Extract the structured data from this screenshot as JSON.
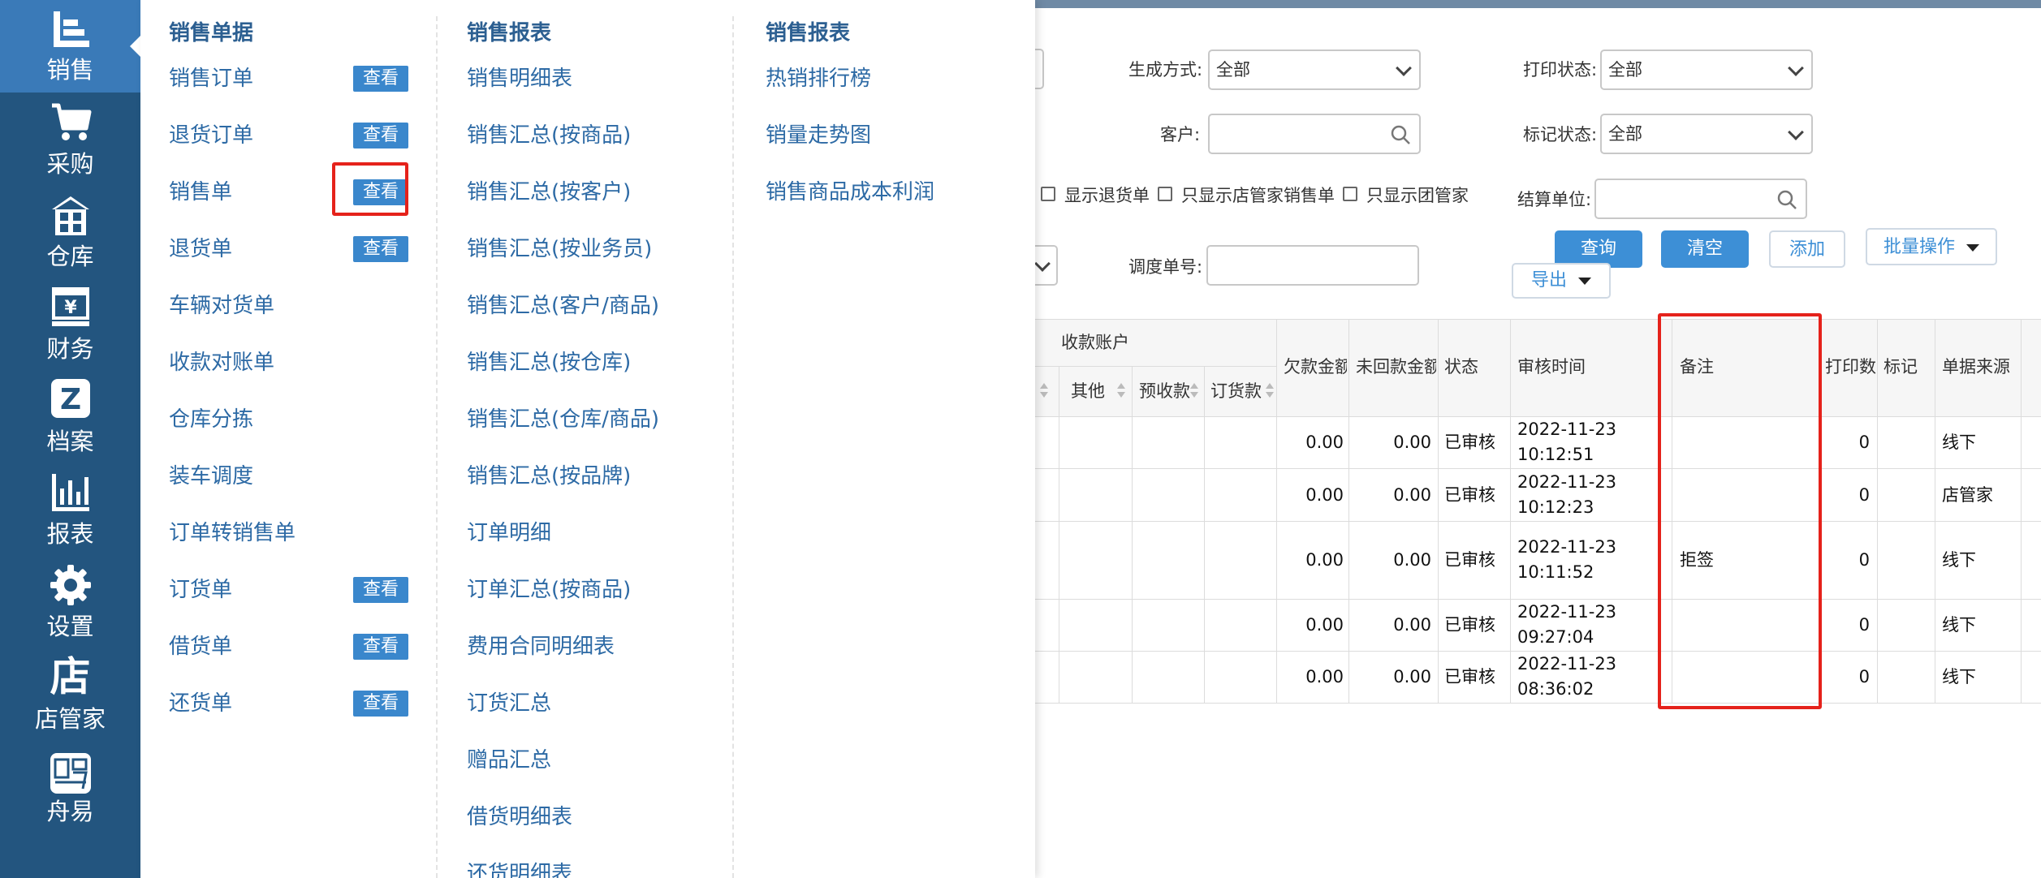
{
  "nav": {
    "items": [
      {
        "label": "销售",
        "icon": "sales-icon"
      },
      {
        "label": "采购",
        "icon": "cart-icon"
      },
      {
        "label": "仓库",
        "icon": "warehouse-icon"
      },
      {
        "label": "财务",
        "icon": "finance-icon"
      },
      {
        "label": "档案",
        "icon": "archive-icon"
      },
      {
        "label": "报表",
        "icon": "report-icon"
      },
      {
        "label": "设置",
        "icon": "gear-icon"
      },
      {
        "label": "店管家",
        "icon": "store-icon"
      },
      {
        "label": "舟易",
        "icon": "zhouyi-icon"
      }
    ]
  },
  "menu": {
    "col1": {
      "title": "销售单据",
      "items": [
        {
          "label": "销售订单",
          "view": "查看"
        },
        {
          "label": "退货订单",
          "view": "查看"
        },
        {
          "label": "销售单",
          "view": "查看"
        },
        {
          "label": "退货单",
          "view": "查看"
        },
        {
          "label": "车辆对货单"
        },
        {
          "label": "收款对账单"
        },
        {
          "label": "仓库分拣"
        },
        {
          "label": "装车调度"
        },
        {
          "label": "订单转销售单"
        },
        {
          "label": "订货单",
          "view": "查看"
        },
        {
          "label": "借货单",
          "view": "查看"
        },
        {
          "label": "还货单",
          "view": "查看"
        }
      ]
    },
    "col2": {
      "title": "销售报表",
      "items": [
        "销售明细表",
        "销售汇总(按商品)",
        "销售汇总(按客户)",
        "销售汇总(按业务员)",
        "销售汇总(客户/商品)",
        "销售汇总(按仓库)",
        "销售汇总(仓库/商品)",
        "销售汇总(按品牌)",
        "订单明细",
        "订单汇总(按商品)",
        "费用合同明细表",
        "订货汇总",
        "赠品汇总",
        "借货明细表",
        "还货明细表"
      ]
    },
    "col3": {
      "title": "销售报表",
      "items": [
        "热销排行榜",
        "销量走势图",
        "销售商品成本利润"
      ]
    }
  },
  "filters": {
    "gen_method_label": "生成方式:",
    "gen_method_value": "全部",
    "print_status_label": "打印状态:",
    "print_status_value": "全部",
    "customer_label": "客户:",
    "mark_status_label": "标记状态:",
    "mark_status_value": "全部",
    "cb_show_return": "显示退货单",
    "cb_only_store": "只显示店管家销售单",
    "cb_only_group": "只显示团管家",
    "settle_unit_label": "结算单位:",
    "dispatch_no_label": "调度单号:",
    "query": "查询",
    "clear": "清空",
    "add": "添加",
    "batch": "批量操作",
    "export": "导出"
  },
  "table": {
    "group_header": "收款账户",
    "sub_headers": [
      "其他",
      "预收款",
      "订货款"
    ],
    "headers": [
      "欠款金额",
      "未回款金额",
      "状态",
      "审核时间",
      "备注",
      "打印数",
      "标记",
      "单据来源"
    ],
    "rows": [
      {
        "debt": "0.00",
        "unpaid": "0.00",
        "status": "已审核",
        "date": "2022-11-23",
        "time": "10:12:51",
        "remark": "",
        "prints": "0",
        "mark": "",
        "source": "线下"
      },
      {
        "debt": "0.00",
        "unpaid": "0.00",
        "status": "已审核",
        "date": "2022-11-23",
        "time": "10:12:23",
        "remark": "",
        "prints": "0",
        "mark": "",
        "source": "店管家"
      },
      {
        "debt": "0.00",
        "unpaid": "0.00",
        "status": "已审核",
        "date": "2022-11-23",
        "time": "10:11:52",
        "remark": "拒签",
        "prints": "0",
        "mark": "",
        "source": "线下"
      },
      {
        "debt": "0.00",
        "unpaid": "0.00",
        "status": "已审核",
        "date": "2022-11-23",
        "time": "09:27:04",
        "remark": "",
        "prints": "0",
        "mark": "",
        "source": "线下"
      },
      {
        "debt": "0.00",
        "unpaid": "0.00",
        "status": "已审核",
        "date": "2022-11-23",
        "time": "08:36:02",
        "remark": "",
        "prints": "0",
        "mark": "",
        "source": "线下"
      }
    ]
  },
  "colors": {
    "nav_bg": "#23557f",
    "nav_active": "#3a7ab8",
    "link": "#2d6aa5",
    "primary": "#3d8fd6",
    "highlight": "#e5221b"
  }
}
